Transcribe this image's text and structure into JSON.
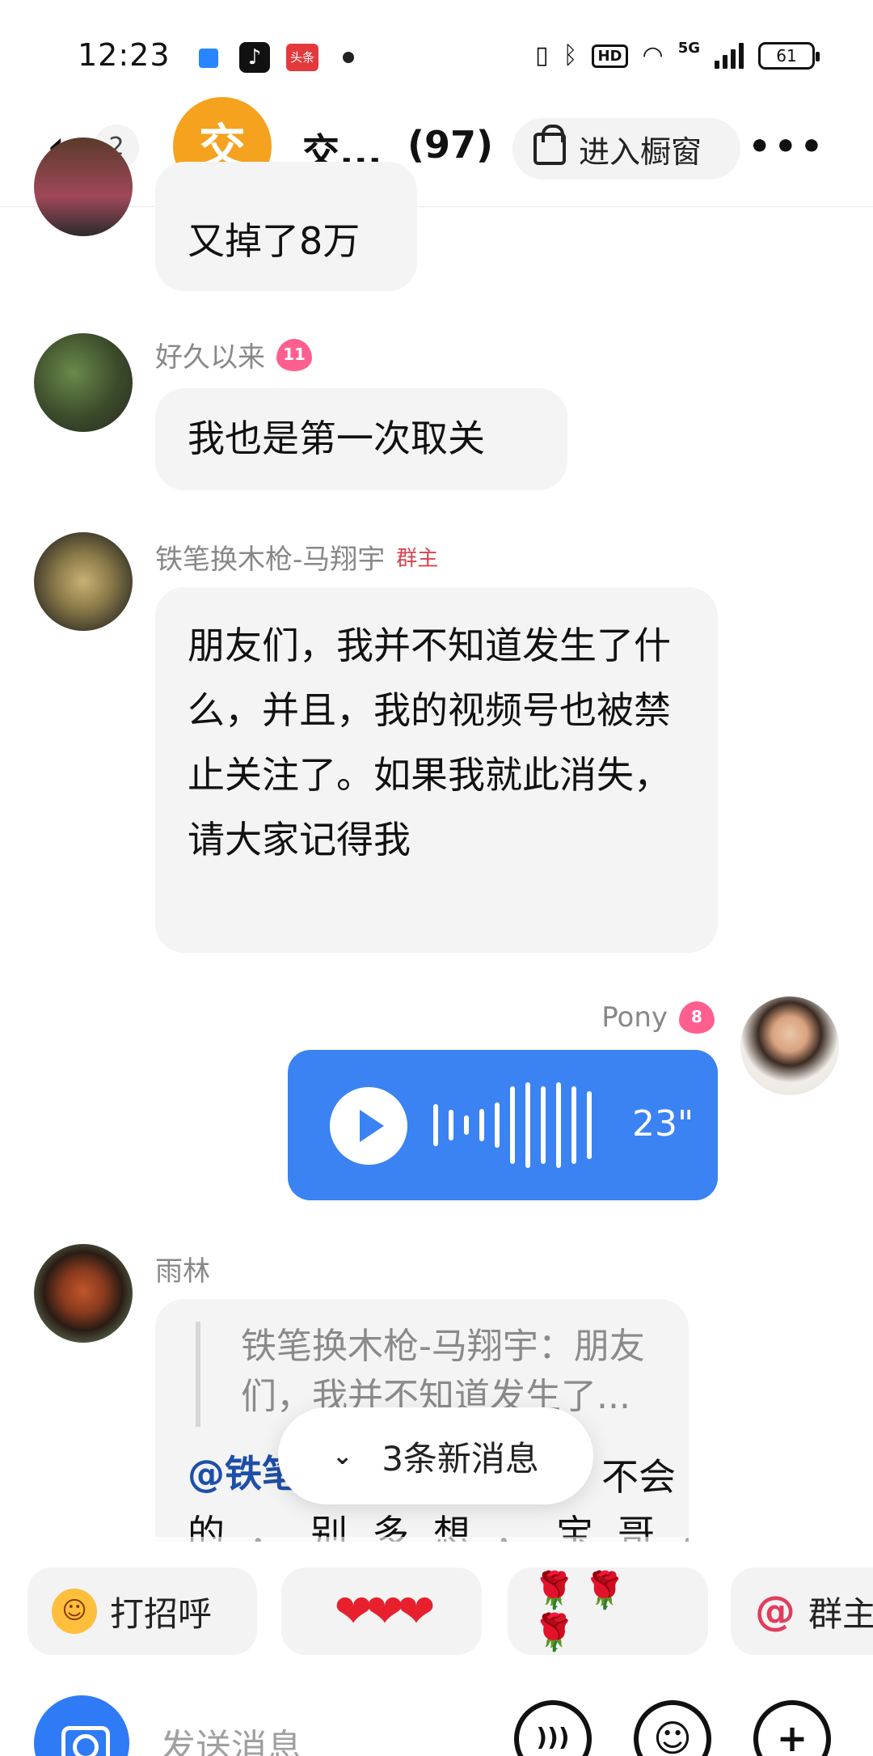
{
  "status_bar": {
    "time": "12:23",
    "app_icons": [
      "notification-icon",
      "tiktok-icon",
      "toutiao-icon"
    ],
    "toutiao_label": "头条",
    "tiktok_glyph": "♪",
    "hd_label": "HD",
    "network_label": "5G",
    "battery": "61"
  },
  "header": {
    "back_glyph": "‹",
    "unread_count": "2",
    "group_avatar_char": "交",
    "group_name": "交...",
    "member_count": "(97)",
    "shop_button_label": "进入橱窗",
    "more_glyph": "•••"
  },
  "messages": {
    "top_bubble": "又掉了8万",
    "haojiu": {
      "sender": "好久以来",
      "level": "11",
      "text": "我也是第一次取关"
    },
    "admin": {
      "sender": "铁笔换木枪-马翔宇",
      "role_tag": "群主",
      "text": "朋友们，我并不知道发生了什么，并且，我的视频号也被禁止关注了。如果我就此消失，请大家记得我"
    },
    "pony": {
      "sender": "Pony",
      "level": "8",
      "voice_duration": "23\""
    },
    "yulin": {
      "sender": "雨林",
      "quote": "铁笔换木枪-马翔宇：朋友们，我并不知道发生了...",
      "mention": "@铁笔",
      "reply_tail": "不会",
      "reply_line2": "的，别多想，宝哥，没事"
    }
  },
  "new_messages": {
    "chevron": "⌄",
    "label": "3条新消息"
  },
  "quick_replies": {
    "greet_emoji": "☺",
    "greet_label": "打招呼",
    "hearts": "❤❤❤",
    "roses": "🌹🌹🌹",
    "at_sign": "@",
    "at_label": "群主"
  },
  "input": {
    "placeholder": "发送消息",
    "voice_glyph": ")))",
    "emoji_glyph": "☺",
    "plus_glyph": "+"
  },
  "colors": {
    "accent_blue": "#3b82f2",
    "group_avatar": "#f5a21e",
    "level_heart": "#ff5f8f",
    "owner_tag": "#d4454f",
    "mention": "#1e4fa8"
  }
}
